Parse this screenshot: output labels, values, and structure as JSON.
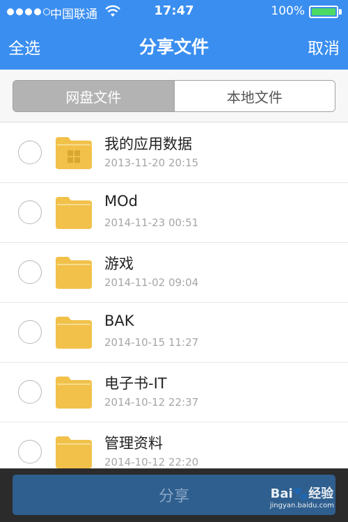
{
  "status_bar": {
    "carrier": "中国联通",
    "time": "17:47",
    "battery": "100%",
    "battery_level": 1.0,
    "signal_icon": "signal-dots-icon",
    "wifi_icon": "wifi-icon"
  },
  "nav": {
    "left": "全选",
    "title": "分享文件",
    "right": "取消"
  },
  "segment": {
    "tabs": [
      {
        "label": "网盘文件",
        "active": true
      },
      {
        "label": "本地文件",
        "active": false
      }
    ]
  },
  "files": [
    {
      "name": "我的应用数据",
      "date": "2013-11-20 20:15",
      "icon": "app-folder-icon"
    },
    {
      "name": "MOd",
      "date": "2014-11-23 00:51",
      "icon": "folder-icon"
    },
    {
      "name": "游戏",
      "date": "2014-11-02 09:04",
      "icon": "folder-icon"
    },
    {
      "name": "BAK",
      "date": "2014-10-15 11:27",
      "icon": "folder-icon"
    },
    {
      "name": "电子书-IT",
      "date": "2014-10-12 22:37",
      "icon": "folder-icon"
    },
    {
      "name": "管理资料",
      "date": "2014-10-12 22:20",
      "icon": "folder-icon"
    }
  ],
  "bottom": {
    "share": "分享"
  },
  "watermark": {
    "logo": "Bai🐾经验",
    "url": "jingyan.baidu.com"
  },
  "colors": {
    "nav_bg": "#3a8ef0",
    "folder": "#f1c14a",
    "share_btn": "#2f5f8f",
    "battery_fill": "#4cd964"
  }
}
